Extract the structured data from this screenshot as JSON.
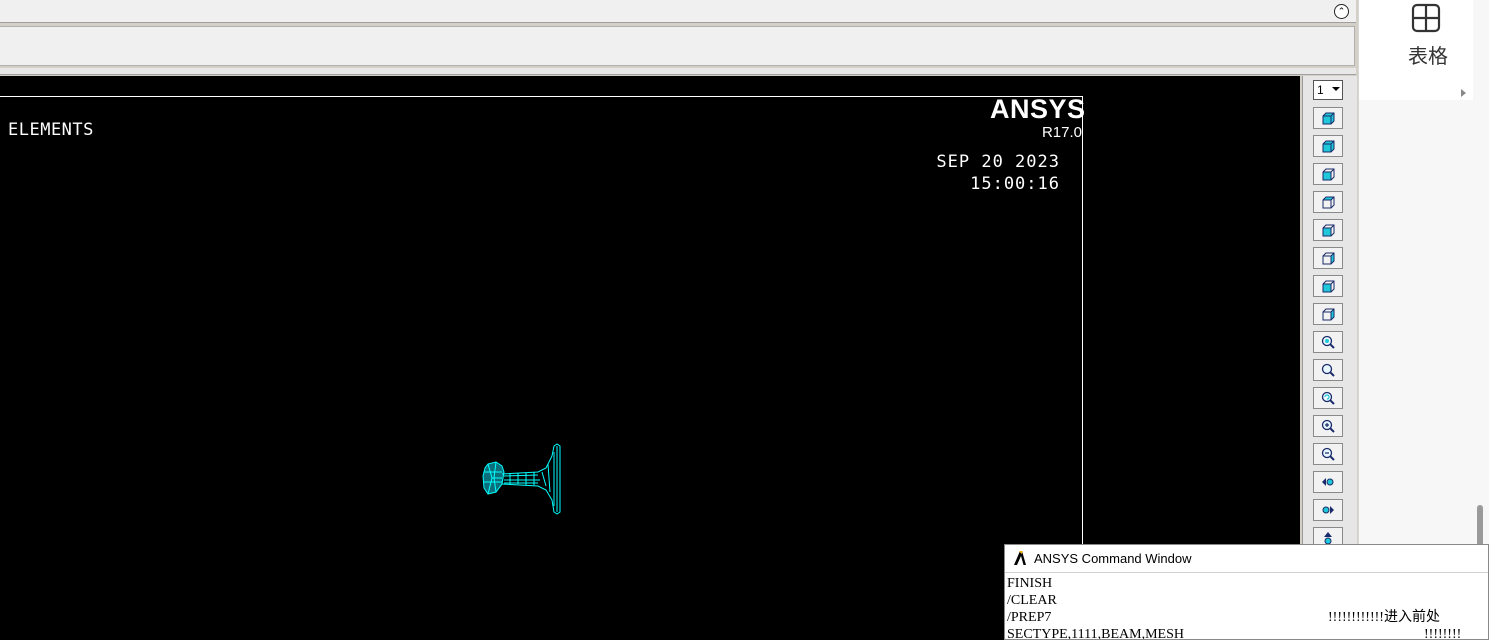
{
  "ansys_window": {
    "collapse_icon": "double-chevron-up-icon",
    "graphics": {
      "label": "ELEMENTS",
      "logo": "ANSYS",
      "version": "R17.0",
      "date": "SEP 20 2023",
      "time": "15:00:16",
      "model_color": "#00ffff"
    },
    "toolbar": {
      "window_number": "1",
      "buttons": [
        "isometric-view-icon",
        "oblique-view-icon",
        "front-view-icon",
        "top-view-icon",
        "left-view-icon",
        "right-view-icon",
        "bottom-view-icon",
        "back-view-icon",
        "fit-view-icon",
        "box-zoom-icon",
        "reset-view-icon",
        "zoom-in-icon",
        "zoom-out-icon",
        "pan-left-icon",
        "pan-right-icon",
        "pan-up-icon"
      ]
    }
  },
  "right_panel": {
    "table_icon": "table-grid-icon",
    "table_label": "表格",
    "expand_icon": "triangle-right-icon"
  },
  "command_window": {
    "title": "ANSYS Command Window",
    "lines": [
      "FINISH",
      "/CLEAR",
      "/PREP7",
      "SECTYPE,1111,BEAM,MESH"
    ],
    "note_line3": "!!!!!!!!!!!!进入前处",
    "note_line4": "!!!!!!!!"
  }
}
